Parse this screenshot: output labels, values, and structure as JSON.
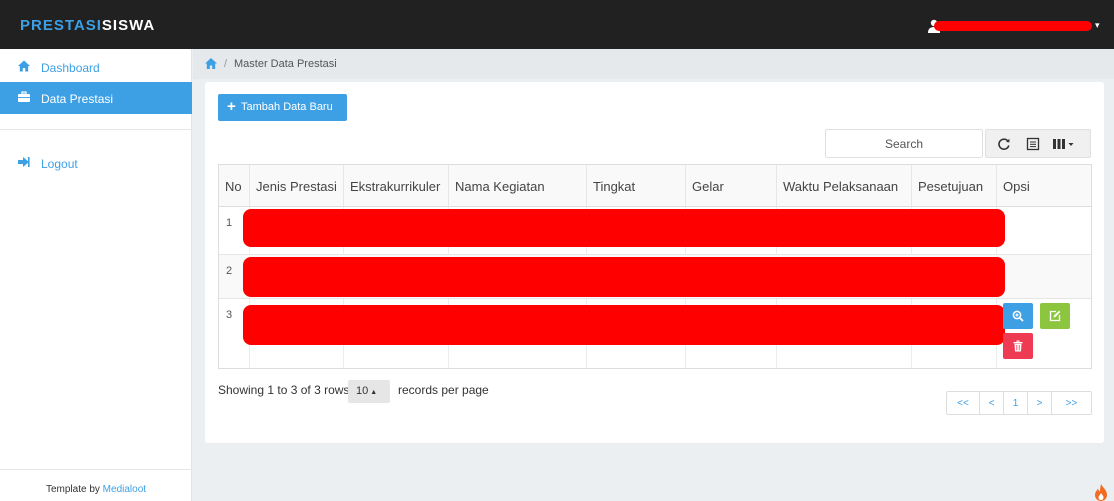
{
  "brand": {
    "part1": "PRESTASI",
    "part2": "SISWA"
  },
  "user": {
    "name": ""
  },
  "sidebar": {
    "items": [
      {
        "label": "Dashboard",
        "icon": "home-icon"
      },
      {
        "label": "Data Prestasi",
        "icon": "briefcase-icon",
        "active": true
      },
      {
        "label": "Logout",
        "icon": "logout-icon"
      }
    ],
    "footer_prefix": "Template by ",
    "footer_link": "Medialoot"
  },
  "breadcrumb": {
    "current": "Master Data Prestasi"
  },
  "toolbar": {
    "add_label": "Tambah Data Baru",
    "search_placeholder": "Search"
  },
  "table": {
    "columns": [
      "No",
      "Jenis Prestasi",
      "Ekstrakurrikuler",
      "Nama Kegiatan",
      "Tingkat",
      "Gelar",
      "Waktu Pelaksanaan",
      "Pesetujuan",
      "Opsi"
    ],
    "rows": [
      {
        "no": "1"
      },
      {
        "no": "2"
      },
      {
        "no": "3"
      }
    ]
  },
  "pagination": {
    "info": "Showing 1 to 3 of 3 rows",
    "page_size": "10",
    "records_label": "records per page",
    "first": "<<",
    "prev": "<",
    "current": "1",
    "next": ">",
    "last": ">>"
  },
  "colors": {
    "accent": "#3ea0e4",
    "topbar": "#212121",
    "edit": "#8cc63f",
    "delete": "#ee3b53",
    "redaction": "#ff0000"
  }
}
